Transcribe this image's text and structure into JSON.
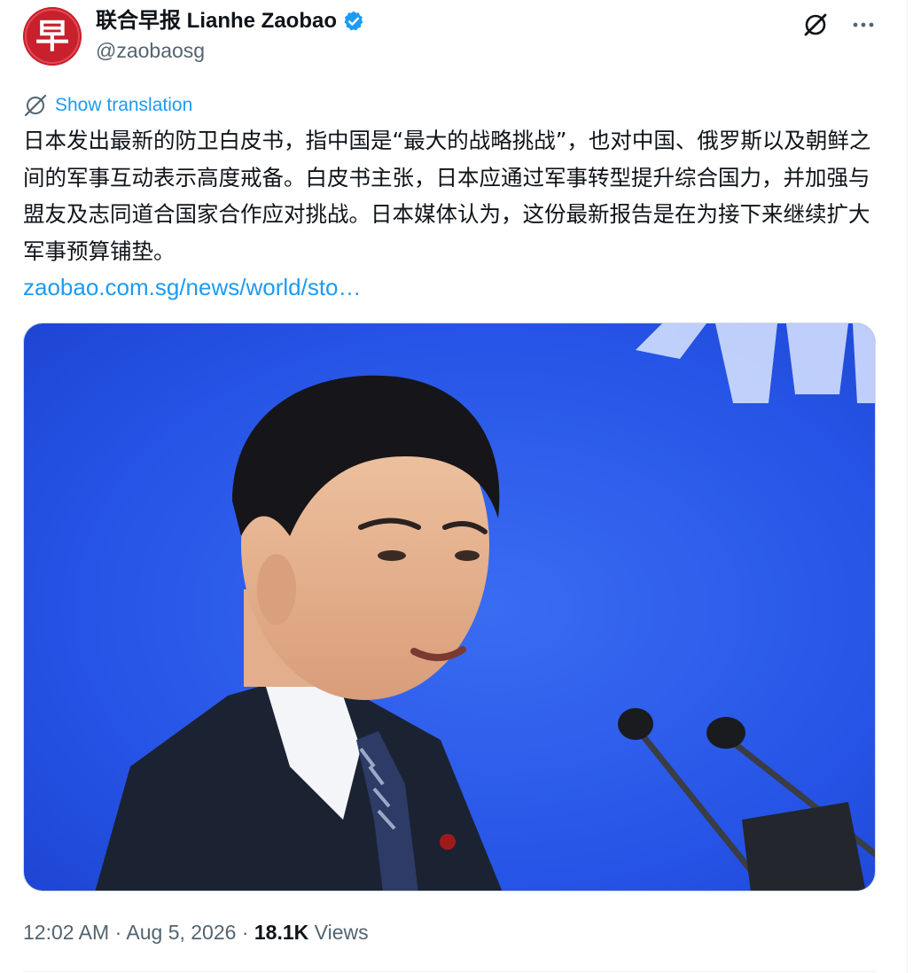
{
  "author": {
    "display_name": "联合早报 Lianhe Zaobao",
    "handle": "@zaobaosg",
    "verified": true,
    "avatar_glyph": "早",
    "avatar_color": "#c8202d"
  },
  "actions": {
    "grok_icon": "grok-icon",
    "more_icon": "more-icon"
  },
  "translate": {
    "icon": "globe-slash-icon",
    "label": "Show translation"
  },
  "tweet": {
    "text": "日本发出最新的防卫白皮书，指中国是“最大的战略挑战”，也对中国、俄罗斯以及朝鲜之间的军事互动表示高度戒备。白皮书主张，日本应通过军事转型提升综合国力，并加强与盟友及志同道合国家合作应对挑战。日本媒体认为，这份最新报告是在为接下来继续扩大军事预算铺垫。",
    "link": "zaobao.com.sg/news/world/sto…"
  },
  "meta": {
    "time": "12:02 AM",
    "separator": "·",
    "date": "Aug 5, 2026",
    "views_count": "18.1K",
    "views_label": "Views"
  },
  "colors": {
    "accent": "#1d9bf0",
    "text": "#0f1419",
    "secondary": "#536471",
    "media_background": "#2454e6"
  }
}
